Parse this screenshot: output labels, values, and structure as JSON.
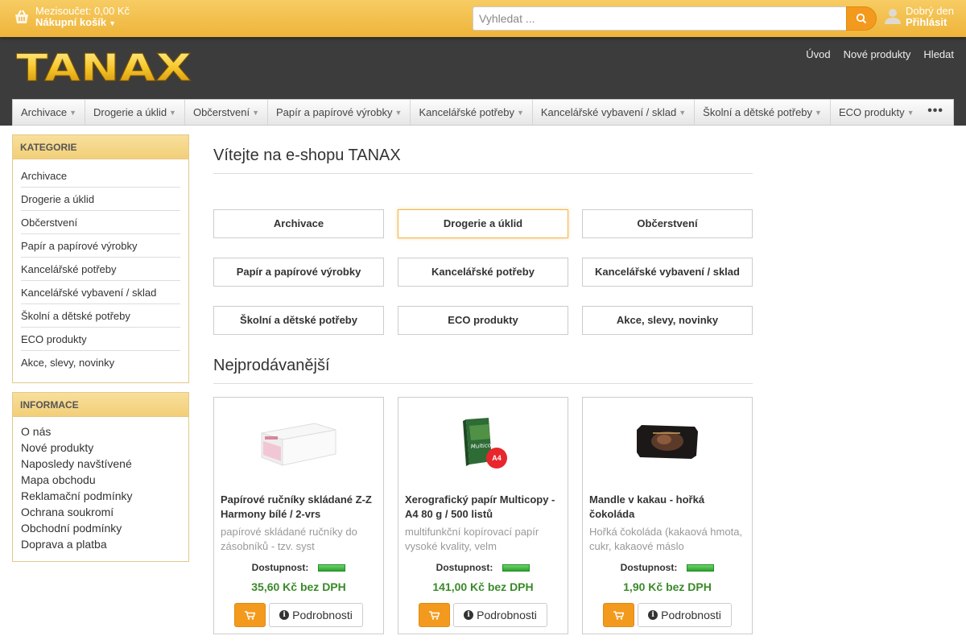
{
  "topbar": {
    "cart_subtotal": "Mezisoučet: 0,00 Kč",
    "cart_label": "Nákupní košík",
    "search_placeholder": "Vyhledat ...",
    "greeting": "Dobrý den",
    "login_label": "Přihlásit"
  },
  "header": {
    "logo_text": "TANAX",
    "links": [
      "Úvod",
      "Nové produkty",
      "Hledat"
    ]
  },
  "menu": [
    "Archivace",
    "Drogerie a úklid",
    "Občerstvení",
    "Papír a papírové výrobky",
    "Kancelářské potřeby",
    "Kancelářské vybavení / sklad",
    "Školní a dětské potřeby",
    "ECO produkty"
  ],
  "sidebar": {
    "categories_title": "KATEGORIE",
    "categories": [
      "Archivace",
      "Drogerie a úklid",
      "Občerstvení",
      "Papír a papírové výrobky",
      "Kancelářské potřeby",
      "Kancelářské vybavení / sklad",
      "Školní a dětské potřeby",
      "ECO produkty",
      "Akce, slevy, novinky"
    ],
    "info_title": "INFORMACE",
    "info": [
      "O nás",
      "Nové produkty",
      "Naposledy navštívené",
      "Mapa obchodu",
      "Reklamační podmínky",
      "Ochrana soukromí",
      "Obchodní podmínky",
      "Doprava a platba"
    ]
  },
  "main": {
    "welcome": "Vítejte na e-shopu TANAX",
    "category_buttons": [
      "Archivace",
      "Drogerie a úklid",
      "Občerstvení",
      "Papír a papírové výrobky",
      "Kancelářské potřeby",
      "Kancelářské vybavení / sklad",
      "Školní a dětské potřeby",
      "ECO produkty",
      "Akce, slevy, novinky"
    ],
    "bestsellers_title": "Nejprodávanější",
    "products": [
      {
        "title": "Papírové ručníky skládané Z-Z Harmony bílé / 2-vrs",
        "desc": "papírové skládané ručníky do zásobníků - tzv. syst",
        "availability": "Dostupnost:",
        "price": "35,60 Kč bez DPH",
        "details": "Podrobnosti"
      },
      {
        "title": "Xerografický papír Multicopy - A4 80 g / 500 listů",
        "desc": "multifunkční kopírovací papír vysoké kvality, velm",
        "availability": "Dostupnost:",
        "price": "141,00 Kč bez DPH",
        "details": "Podrobnosti",
        "badge": "A4"
      },
      {
        "title": "Mandle v kakau - hořká čokoláda",
        "desc": "Hořká čokoláda (kakaová hmota, cukr, kakaové máslo",
        "availability": "Dostupnost:",
        "price": "1,90 Kč bez DPH",
        "details": "Podrobnosti"
      }
    ]
  },
  "colors": {
    "accent": "#f39a1e",
    "topbar": "#f2c04c",
    "dark_bg": "#3c3c3c",
    "price": "#3a8a2a"
  }
}
